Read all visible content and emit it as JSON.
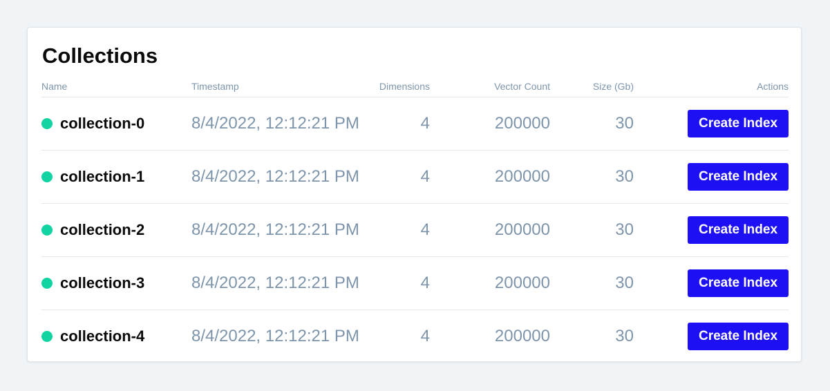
{
  "page": {
    "title": "Collections"
  },
  "table": {
    "headers": {
      "name": "Name",
      "timestamp": "Timestamp",
      "dimensions": "Dimensions",
      "vector_count": "Vector Count",
      "size": "Size (Gb)",
      "actions": "Actions"
    },
    "rows": [
      {
        "name": "collection-0",
        "timestamp": "8/4/2022, 12:12:21 PM",
        "dimensions": "4",
        "vector_count": "200000",
        "size": "30",
        "action_label": "Create Index"
      },
      {
        "name": "collection-1",
        "timestamp": "8/4/2022, 12:12:21 PM",
        "dimensions": "4",
        "vector_count": "200000",
        "size": "30",
        "action_label": "Create Index"
      },
      {
        "name": "collection-2",
        "timestamp": "8/4/2022, 12:12:21 PM",
        "dimensions": "4",
        "vector_count": "200000",
        "size": "30",
        "action_label": "Create Index"
      },
      {
        "name": "collection-3",
        "timestamp": "8/4/2022, 12:12:21 PM",
        "dimensions": "4",
        "vector_count": "200000",
        "size": "30",
        "action_label": "Create Index"
      },
      {
        "name": "collection-4",
        "timestamp": "8/4/2022, 12:12:21 PM",
        "dimensions": "4",
        "vector_count": "200000",
        "size": "30",
        "action_label": "Create Index"
      }
    ]
  },
  "colors": {
    "status_ready": "#12d4a3",
    "primary_button": "#1e10f5",
    "muted_text": "#7d94ab",
    "background": "#f0f4f7"
  },
  "icons": {
    "status": "status-dot-icon"
  }
}
